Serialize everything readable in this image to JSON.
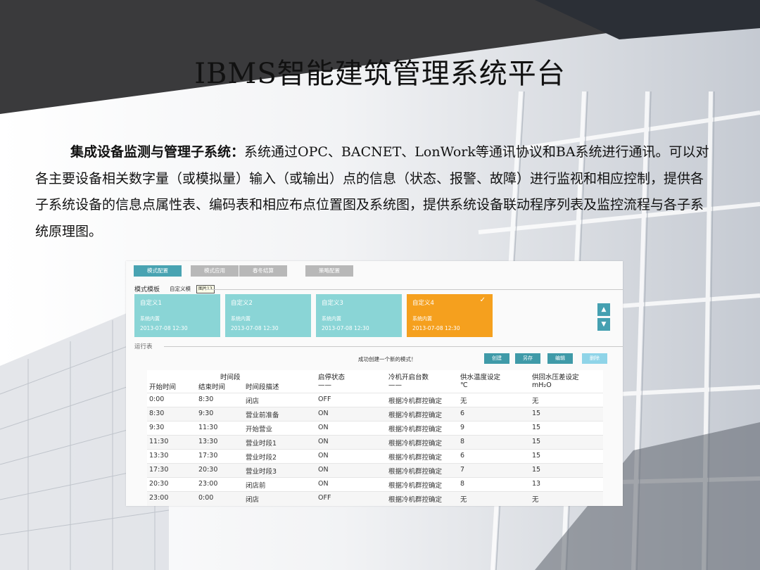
{
  "slide": {
    "title": "IBMS智能建筑管理系统平台",
    "body_bold": "集成设备监测与管理子系统：",
    "body_text": "系统通过OPC、BACNET、LonWork等通讯协议和BA系统进行通讯。可以对各主要设备相关数字量（或模拟量）输入（或输出）点的信息（状态、报警、故障）进行监视和相应控制，提供各子系统设备的信息点属性表、编码表和相应布点位置图及系统图，提供系统设备联动程序列表及监控流程与各子系统原理图。"
  },
  "ui": {
    "tabs": [
      {
        "label": "模式配置",
        "active": true
      },
      {
        "label": "模式应用",
        "active": false
      },
      {
        "label": "春冬结算",
        "active": false
      },
      {
        "label": "策略配置",
        "active": false
      }
    ],
    "template_section_label": "模式模板",
    "template_hint": "自定义模",
    "tooltip": "图片13",
    "cards": [
      {
        "title": "自定义1",
        "subtitle": "系统内置",
        "date": "2013-07-08  12:30",
        "selected": false
      },
      {
        "title": "自定义2",
        "subtitle": "系统内置",
        "date": "2013-07-08  12:30",
        "selected": false
      },
      {
        "title": "自定义3",
        "subtitle": "系统内置",
        "date": "2013-07-08  12:30",
        "selected": false
      },
      {
        "title": "自定义4",
        "subtitle": "系统内置",
        "date": "2013-07-08  12:30",
        "selected": true,
        "check": "✓"
      }
    ],
    "nav_up": "▲",
    "nav_down": "▼",
    "schedule_label": "运行表",
    "message": "成功创建一个新的模式！",
    "action_buttons": [
      "创建",
      "另存",
      "编辑",
      "删除"
    ],
    "table": {
      "group_header": "时间段",
      "headers": [
        "开始时间",
        "结束时间",
        "时间段描述",
        "启停状态",
        "冷机开启台数",
        "供水温度设定",
        "供回水压差设定"
      ],
      "header_subs": [
        "——",
        "——",
        "℃",
        "mH₂O"
      ],
      "rows": [
        [
          "0:00",
          "8:30",
          "闭店",
          "OFF",
          "根据冷机群控确定",
          "无",
          "无"
        ],
        [
          "8:30",
          "9:30",
          "营业前准备",
          "ON",
          "根据冷机群控确定",
          "6",
          "15"
        ],
        [
          "9:30",
          "11:30",
          "开始营业",
          "ON",
          "根据冷机群控确定",
          "9",
          "15"
        ],
        [
          "11:30",
          "13:30",
          "营业时段1",
          "ON",
          "根据冷机群控确定",
          "8",
          "15"
        ],
        [
          "13:30",
          "17:30",
          "营业时段2",
          "ON",
          "根据冷机群控确定",
          "6",
          "15"
        ],
        [
          "17:30",
          "20:30",
          "营业时段3",
          "ON",
          "根据冷机群控确定",
          "7",
          "15"
        ],
        [
          "20:30",
          "23:00",
          "闭店前",
          "ON",
          "根据冷机群控确定",
          "8",
          "13"
        ],
        [
          "23:00",
          "0:00",
          "闭店",
          "OFF",
          "根据冷机群控确定",
          "无",
          "无"
        ]
      ]
    }
  }
}
